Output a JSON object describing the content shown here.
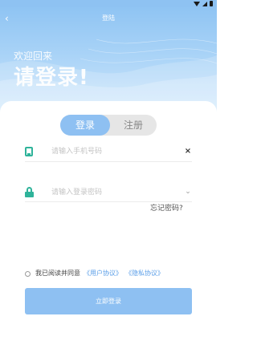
{
  "header": {
    "title": "登陆",
    "back_icon": "back-chevron-icon",
    "welcome": "欢迎回来",
    "headline": "请登录!",
    "gradient_colors": [
      "#8fc4f3",
      "#cfe7fb"
    ]
  },
  "tabs": {
    "login_label": "登录",
    "register_label": "注册",
    "active": "login",
    "active_color": "#8ec0f2"
  },
  "form": {
    "phone_placeholder": "请输入手机号码",
    "phone_value": "",
    "phone_icon": "phone-icon",
    "clear_symbol": "×",
    "password_placeholder": "请输入登录密码",
    "password_value": "",
    "lock_icon": "lock-icon",
    "toggle_symbol": "⌄",
    "forgot_label": "忘记密码?"
  },
  "agreement": {
    "prefix": "我已阅读并同意",
    "user_agreement": "《用户协议》",
    "privacy_policy": "《隐私协议》",
    "checked": false,
    "link_color": "#5a9ee8"
  },
  "submit": {
    "label": "立即登录",
    "color": "#8ec0f2"
  },
  "accent_color": "#2fb39a"
}
